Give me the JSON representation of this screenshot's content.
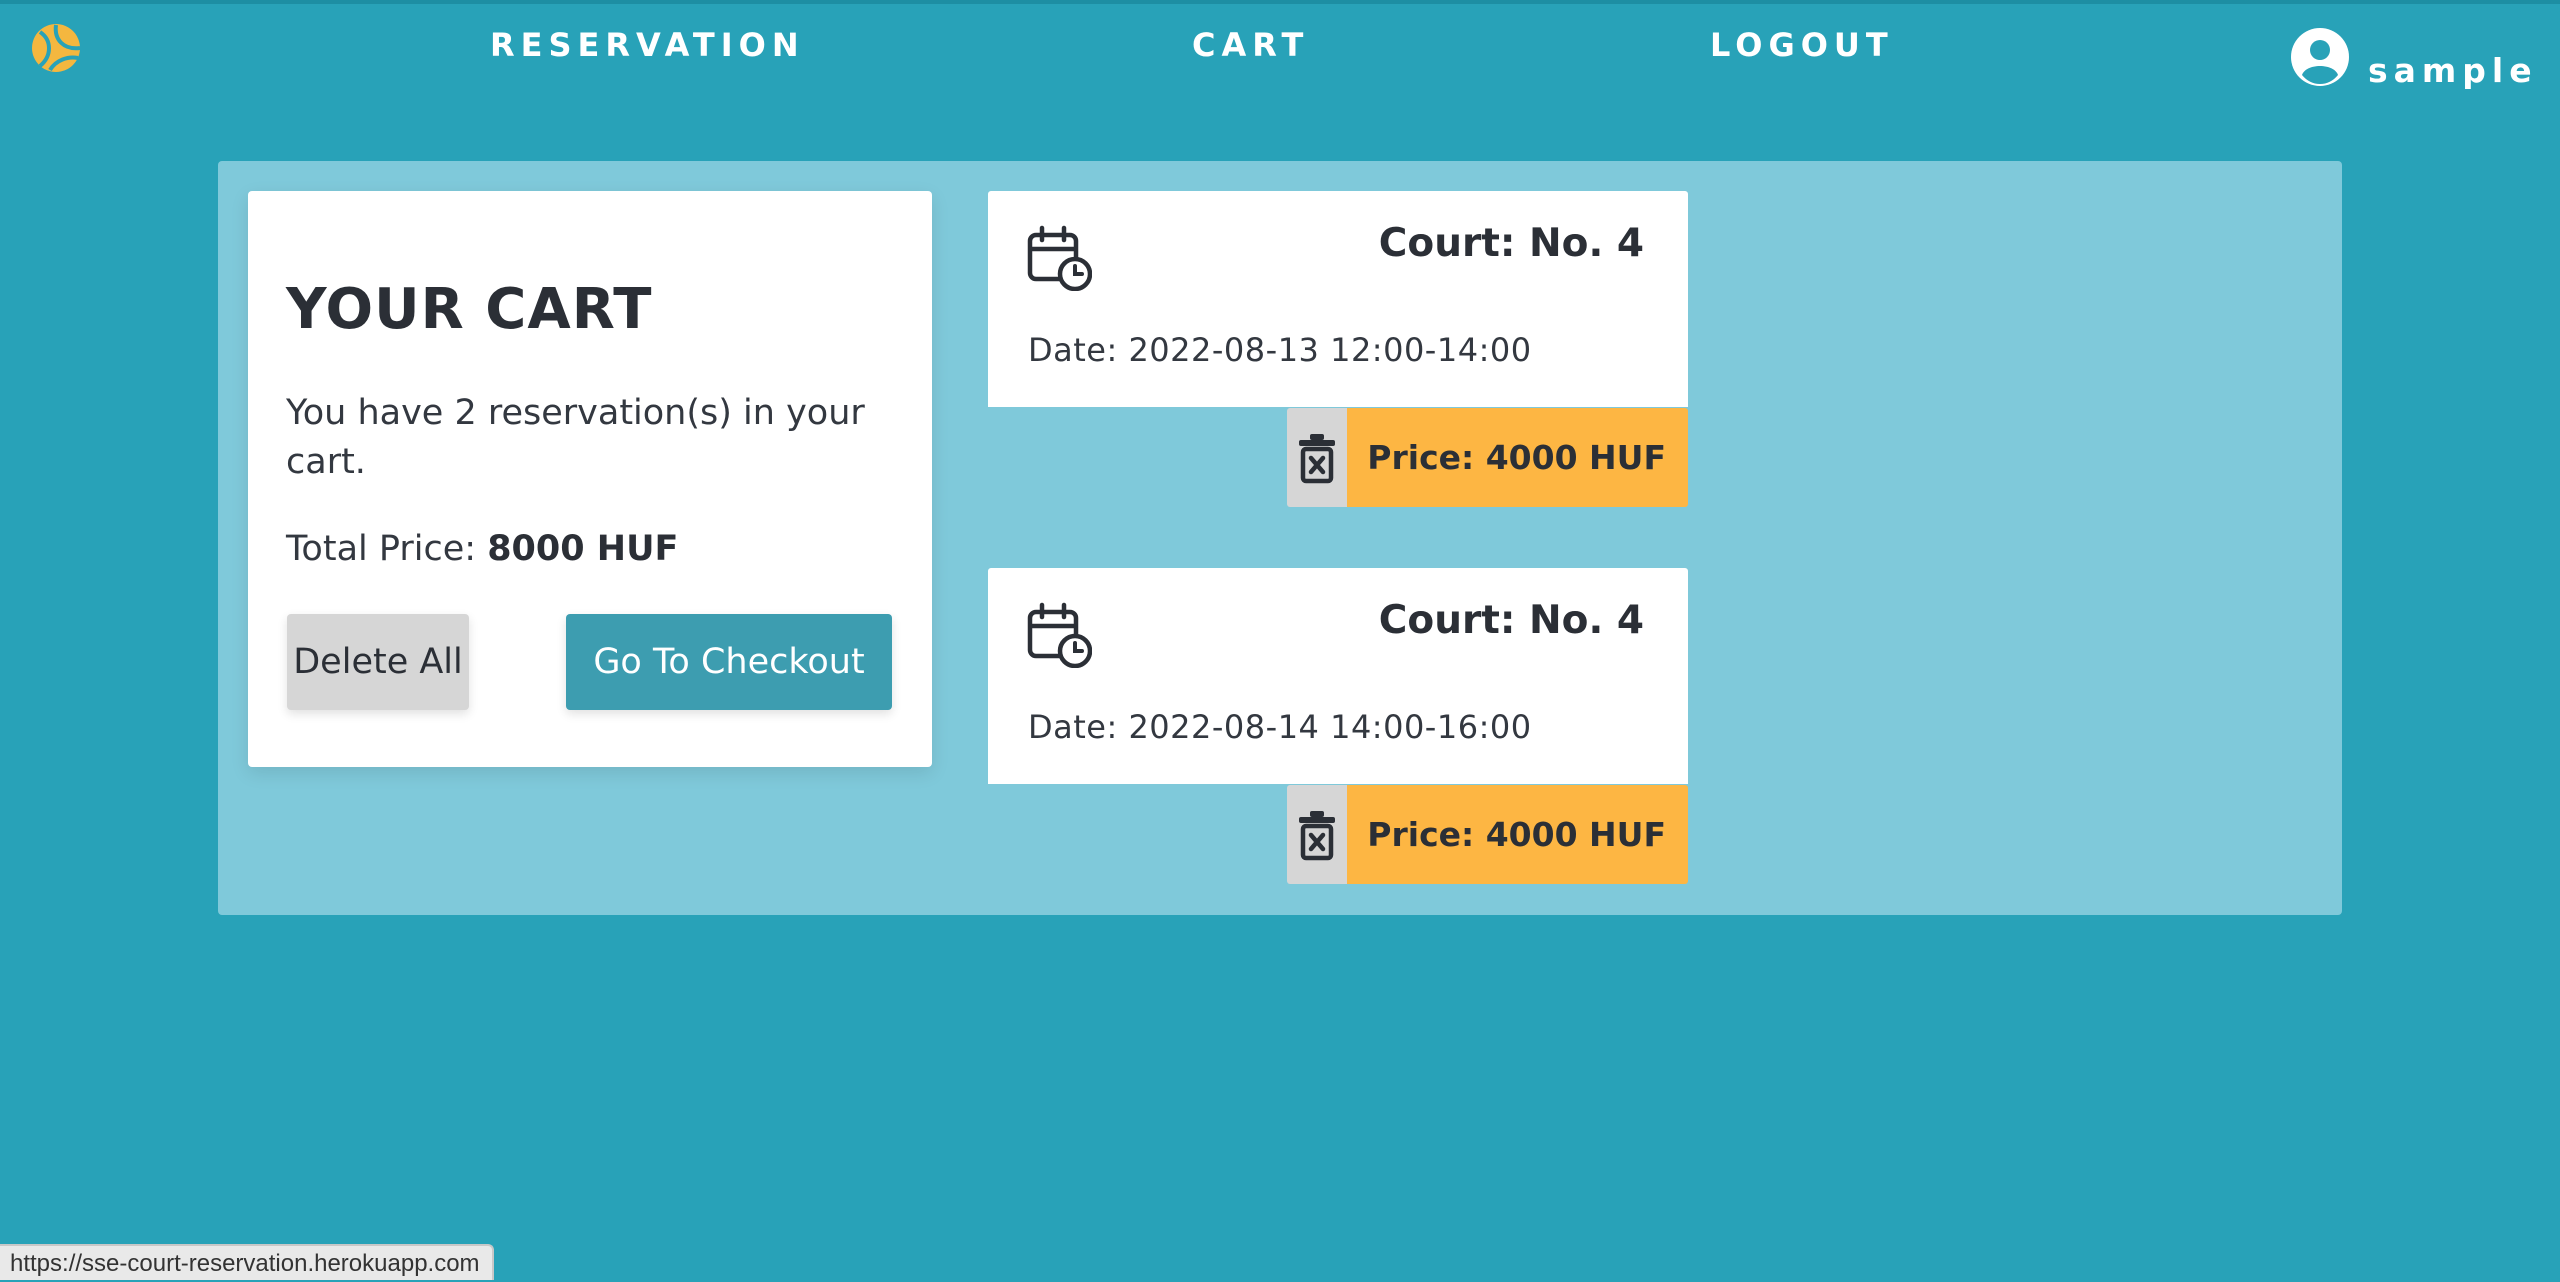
{
  "colors": {
    "background": "#28a2b8",
    "panel": "#7fc9da",
    "accent": "#fdb643",
    "checkout_button": "#3d9db0",
    "neutral_button": "#d6d6d6"
  },
  "nav": {
    "logo_icon": "tennis-ball-icon",
    "links": [
      {
        "label": "RESERVATION"
      },
      {
        "label": "CART"
      },
      {
        "label": "LOGOUT"
      }
    ],
    "user": {
      "icon": "user-circle-icon",
      "name": "sample"
    }
  },
  "cart": {
    "title": "YOUR CART",
    "summary": "You have 2 reservation(s) in your cart.",
    "total_label": "Total Price:",
    "total_value": "8000 HUF",
    "delete_all_label": "Delete All",
    "checkout_label": "Go To Checkout"
  },
  "reservations": [
    {
      "icon": "calendar-clock-icon",
      "court": "Court: No. 4",
      "date": "Date: 2022-08-13 12:00-14:00",
      "delete_icon": "trash-icon",
      "price": "Price: 4000 HUF"
    },
    {
      "icon": "calendar-clock-icon",
      "court": "Court: No. 4",
      "date": "Date: 2022-08-14 14:00-16:00",
      "delete_icon": "trash-icon",
      "price": "Price: 4000 HUF"
    }
  ],
  "status_bar": {
    "url": "https://sse-court-reservation.herokuapp.com"
  }
}
